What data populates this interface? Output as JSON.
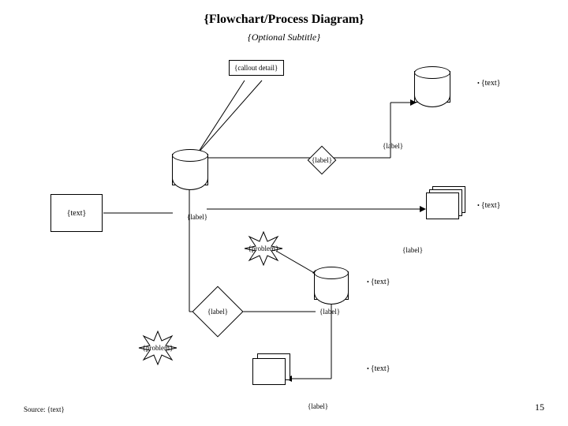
{
  "title": "{Flowchart/Process Diagram}",
  "subtitle": "{Optional Subtitle}",
  "callout_detail": "{callout detail}",
  "labels": {
    "l1": "{label}",
    "l2": "{label}",
    "l3": "{label}",
    "l4": "{label}",
    "l5": "{label}",
    "l6": "{label}",
    "l7": "{label}"
  },
  "text_side_box": "{text}",
  "text_bullet1": "{text}",
  "text_bullet2": "{text}",
  "text_bullet3": "{text}",
  "text_bullet4": "{text}",
  "burst1": "{problem}",
  "burst2": "{problem}",
  "source": "Source: {text}",
  "page_number": "15"
}
